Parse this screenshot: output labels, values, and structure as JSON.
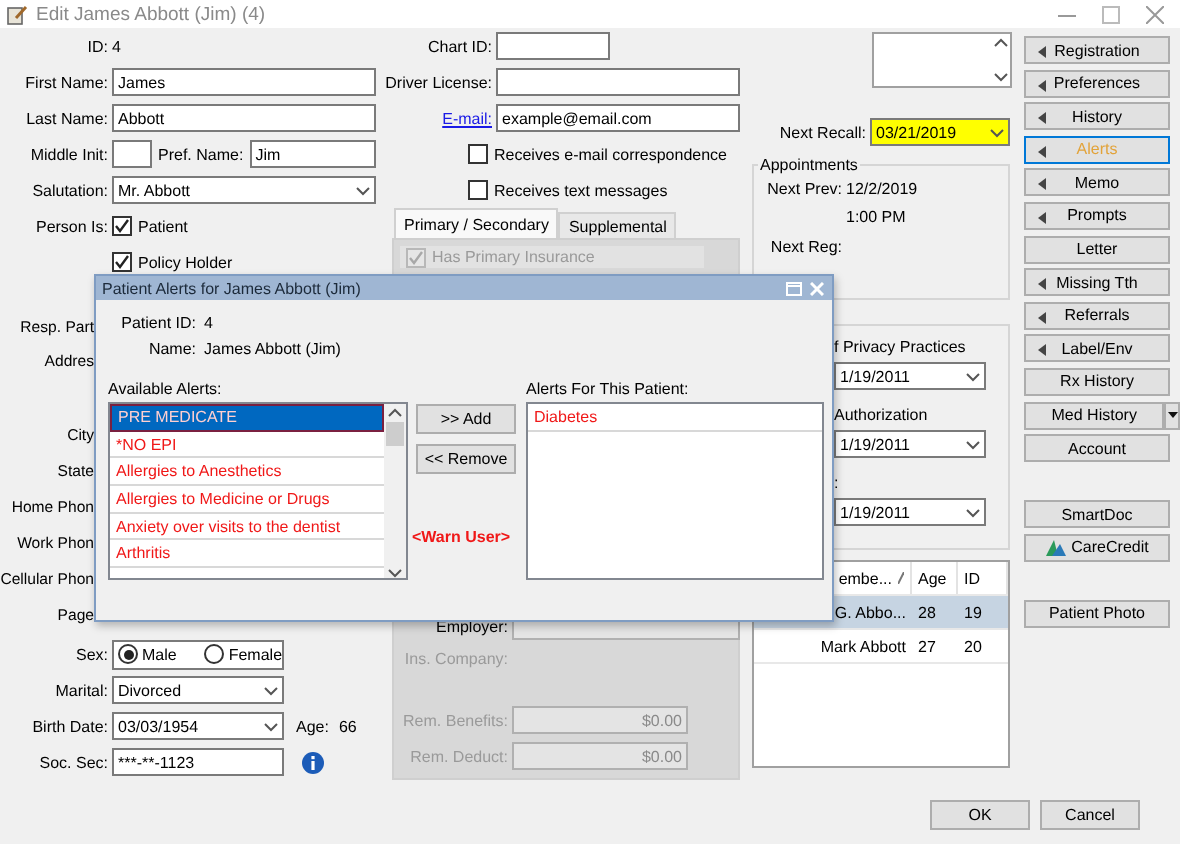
{
  "window": {
    "title": "Edit James Abbott (Jim) (4)"
  },
  "identity": {
    "id_label": "ID:",
    "id": "4",
    "first_name_label": "First Name:",
    "first_name": "James",
    "last_name_label": "Last Name:",
    "last_name": "Abbott",
    "middle_init_label": "Middle Init:",
    "pref_name_label": "Pref. Name:",
    "pref_name": "Jim",
    "salutation_label": "Salutation:",
    "salutation": "Mr. Abbott",
    "person_is_label": "Person Is:",
    "roles": [
      {
        "label": "Patient",
        "checked": true
      },
      {
        "label": "Policy Holder",
        "checked": true
      }
    ]
  },
  "covered_labels": [
    {
      "label": "Resp. Part",
      "kind": "single"
    },
    {
      "label": "Addres",
      "kind": "double"
    },
    {
      "label": "City",
      "kind": "single"
    },
    {
      "label": "State",
      "kind": "single"
    },
    {
      "label": "Home Phon",
      "kind": "single"
    },
    {
      "label": "Work Phon",
      "kind": "single"
    },
    {
      "label": "Cellular Phon",
      "kind": "single"
    },
    {
      "label": "Page",
      "kind": "single"
    }
  ],
  "sex": {
    "label": "Sex:",
    "options": [
      {
        "label": "Male",
        "selected": true
      },
      {
        "label": "Female",
        "selected": false
      }
    ]
  },
  "marital": {
    "label": "Marital:",
    "value": "Divorced"
  },
  "birth_date": {
    "label": "Birth Date:",
    "value": "03/03/1954",
    "age_label": "Age:",
    "age": "66"
  },
  "soc_sec": {
    "label": "Soc. Sec:",
    "value": "***-**-1123"
  },
  "contact": {
    "chart_id_label": "Chart ID:",
    "driver_license_label": "Driver License:",
    "email_label": "E-mail:",
    "email": "example@email.com",
    "options": [
      {
        "label": "Receives e-mail correspondence",
        "checked": false
      },
      {
        "label": "Receives text messages",
        "checked": false
      }
    ]
  },
  "insurance": {
    "tabs": [
      {
        "label": "Primary / Secondary",
        "selected": true
      },
      {
        "label": "Supplemental",
        "selected": false
      }
    ],
    "has_primary": {
      "label": "Has Primary Insurance",
      "checked": true
    },
    "employer_label": "Employer:",
    "ins_company_label": "Ins. Company:",
    "rem_benefits_label": "Rem. Benefits:",
    "rem_benefits": "$0.00",
    "rem_deduct_label": "Rem. Deduct:",
    "rem_deduct": "$0.00"
  },
  "recall": {
    "label": "Next Recall:",
    "value": "03/21/2019"
  },
  "appointments": {
    "title": "Appointments",
    "next_prev_label": "Next Prev:",
    "next_prev_date": "12/2/2019",
    "next_prev_time": "1:00 PM",
    "next_reg_label": "Next Reg:"
  },
  "privacy": {
    "rows": [
      {
        "label": "f Privacy Practices",
        "date": "1/19/2011"
      },
      {
        "label": "Authorization",
        "date": "1/19/2011"
      },
      {
        "label": ":",
        "date": "1/19/2011"
      }
    ]
  },
  "family": {
    "columns": [
      "embe...",
      "Age",
      "ID"
    ],
    "rows": [
      {
        "cells": [
          "G. Abbo...",
          "28",
          "19"
        ],
        "selected": true
      },
      {
        "cells": [
          "Mark Abbott",
          "27",
          "20"
        ],
        "selected": false
      }
    ]
  },
  "side_buttons": [
    {
      "buttons": [
        {
          "label": "Registration",
          "kind": "arrow",
          "selected": false
        },
        {
          "label": "Preferences",
          "kind": "arrow",
          "selected": false
        },
        {
          "label": "History",
          "kind": "arrow",
          "selected": false
        },
        {
          "label": "Alerts",
          "kind": "arrow",
          "selected": true
        },
        {
          "label": "Memo",
          "kind": "arrow",
          "selected": false
        },
        {
          "label": "Prompts",
          "kind": "arrow",
          "selected": false
        },
        {
          "label": "Letter",
          "kind": "plain",
          "selected": false
        },
        {
          "label": "Missing Tth",
          "kind": "arrow",
          "selected": false
        },
        {
          "label": "Referrals",
          "kind": "arrow",
          "selected": false
        },
        {
          "label": "Label/Env",
          "kind": "arrow",
          "selected": false
        },
        {
          "label": "Rx History",
          "kind": "plain",
          "selected": false
        },
        {
          "label": "Med History",
          "kind": "split",
          "selected": false
        },
        {
          "label": "Account",
          "kind": "plain",
          "selected": false
        }
      ]
    },
    {
      "buttons": [
        {
          "label": "SmartDoc",
          "kind": "plain",
          "selected": false
        },
        {
          "label": "CareCredit",
          "kind": "logo",
          "selected": false
        }
      ]
    },
    {
      "buttons": [
        {
          "label": "Patient Photo",
          "kind": "plain",
          "selected": false
        }
      ]
    }
  ],
  "footer_buttons": [
    "OK",
    "Cancel"
  ],
  "dialog": {
    "title": "Patient Alerts for James Abbott (Jim)",
    "patient_id_label": "Patient ID:",
    "patient_id": "4",
    "name_label": "Name:",
    "name": "James Abbott (Jim)",
    "available_label": "Available Alerts:",
    "available": [
      {
        "label": "PRE MEDICATE",
        "selected": true
      },
      {
        "label": "*NO EPI",
        "selected": false
      },
      {
        "label": "Allergies to Anesthetics",
        "selected": false
      },
      {
        "label": "Allergies to Medicine or Drugs",
        "selected": false
      },
      {
        "label": "Anxiety over visits to the dentist",
        "selected": false
      },
      {
        "label": "Arthritis",
        "selected": false
      }
    ],
    "add": ">> Add",
    "remove": "<< Remove",
    "warn": "<Warn User>",
    "patient_label": "Alerts For This Patient:",
    "patient_alerts": [
      "Diabetes"
    ]
  }
}
